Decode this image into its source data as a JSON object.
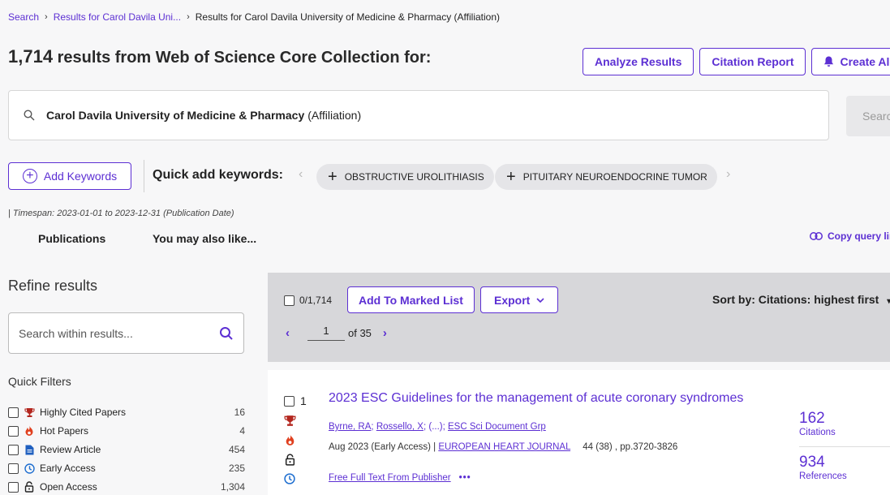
{
  "breadcrumb": {
    "root": "Search",
    "parent": "Results for Carol Davila Uni...",
    "current": "Results for Carol Davila University of Medicine & Pharmacy (Affiliation)"
  },
  "header": {
    "count": "1,714",
    "suffix": " results from Web of Science Core Collection for:",
    "analyze_label": "Analyze Results",
    "citation_report_label": "Citation Report",
    "create_alert_label": "Create Alert"
  },
  "query": {
    "term": "Carol Davila University of Medicine & Pharmacy",
    "field": "(Affiliation)",
    "search_label": "Search"
  },
  "keywords": {
    "add_label": "Add Keywords",
    "quick_add_label": "Quick add keywords:",
    "chips": [
      "OBSTRUCTIVE UROLITHIASIS",
      "PITUITARY NEUROENDOCRINE TUMOR"
    ]
  },
  "timespan": "| Timespan: 2023-01-01 to 2023-12-31 (Publication Date)",
  "tabs": [
    "Publications",
    "You may also like..."
  ],
  "copy_query_label": "Copy query link",
  "sidebar": {
    "refine_title": "Refine results",
    "search_placeholder": "Search within results...",
    "quick_filters_title": "Quick Filters",
    "filters": [
      {
        "label": "Highly Cited Papers",
        "count": "16",
        "icon": "trophy-icon"
      },
      {
        "label": "Hot Papers",
        "count": "4",
        "icon": "flame-icon"
      },
      {
        "label": "Review Article",
        "count": "454",
        "icon": "document-icon"
      },
      {
        "label": "Early Access",
        "count": "235",
        "icon": "clock-icon"
      },
      {
        "label": "Open Access",
        "count": "1,304",
        "icon": "lock-icon"
      }
    ]
  },
  "toolbar": {
    "selection": "0/1,714",
    "add_marked_label": "Add To Marked List",
    "export_label": "Export",
    "sort_label": "Sort by: Citations: highest first",
    "page": "1",
    "of_pages": "of 35"
  },
  "record": {
    "number": "1",
    "title": "2023 ESC Guidelines for the management of acute coronary syndromes",
    "authors": [
      "Byrne, RA",
      "Rossello, X",
      "(...)",
      "ESC Sci Document Grp"
    ],
    "date": "Aug 2023 (Early Access) | ",
    "journal": "EUROPEAN HEART JOURNAL",
    "volume": "44 (38) , pp.3720-3826",
    "full_text_label": "Free Full Text From Publisher",
    "more_label": "•••",
    "citations": "162",
    "citations_label": "Citations",
    "references": "934",
    "references_label": "References"
  },
  "colors": {
    "accent": "#5c2fd3",
    "highly_cited": "#b3261e",
    "hot": "#e0401f",
    "review": "#1f5fbf",
    "early_access": "#1f6fd0"
  }
}
